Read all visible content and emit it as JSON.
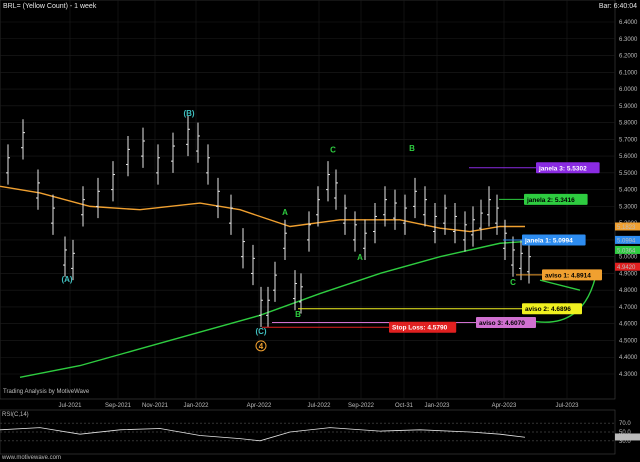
{
  "header": {
    "symbol_title": "BRL= (Yellow Count) - 1 week",
    "bar_time": "Bar: 6:40:04"
  },
  "footer": {
    "credit": "Trading Analysis by MotiveWave",
    "watermark": "www.motivewave.com"
  },
  "rsi_panel": {
    "title": "RSI(C,14)",
    "ticks": [
      "70.0",
      "50.0",
      "30.0"
    ],
    "current_value": "38.7"
  },
  "chart_data": {
    "type": "candlestick",
    "title": "BRL= (Yellow Count) - 1 week",
    "x_ticks": [
      "Jul-2021",
      "Sep-2021",
      "Nov-2021",
      "Jan-2022",
      "Apr-2022",
      "Jul-2022",
      "Sep-2022",
      "Oct-31",
      "Jan-2023",
      "Apr-2023",
      "Jul-2023"
    ],
    "y_ticks": [
      "6.4000",
      "6.3000",
      "6.2000",
      "6.1000",
      "6.0000",
      "5.9000",
      "5.8000",
      "5.7000",
      "5.6000",
      "5.5000",
      "5.4000",
      "5.3000",
      "5.2000",
      "5.1000",
      "5.0000",
      "4.9000",
      "4.8000",
      "4.7000",
      "4.6000",
      "4.5000",
      "4.4000",
      "4.3000"
    ],
    "ylim": [
      4.25,
      6.45
    ],
    "price_tags": [
      {
        "text": "5.1823",
        "color": "#f0a030"
      },
      {
        "text": "5.0994",
        "color": "#2d8cf0"
      },
      {
        "text": "5.0364",
        "color": "#2ecc40"
      },
      {
        "text": "4.9420",
        "color": "#e02020"
      }
    ],
    "levels": [
      {
        "label": "janela 3: 5.5302",
        "value": 5.5302,
        "color": "#8a2be2",
        "text_color": "#ffffff"
      },
      {
        "label": "janela 2: 5.3416",
        "value": 5.3416,
        "color": "#2ecc40",
        "text_color": "#000000"
      },
      {
        "label": "janela 1: 5.0994",
        "value": 5.0994,
        "color": "#2d8cf0",
        "text_color": "#ffffff"
      },
      {
        "label": "aviso 1: 4.8914",
        "value": 4.8914,
        "color": "#f0a030",
        "text_color": "#000000"
      },
      {
        "label": "aviso 2: 4.6896",
        "value": 4.6896,
        "color": "#f0f020",
        "text_color": "#000000"
      },
      {
        "label": "aviso 3: 4.6070",
        "value": 4.607,
        "color": "#d070d0",
        "text_color": "#000000"
      },
      {
        "label": "Stop Loss: 4.5790",
        "value": 4.579,
        "color": "#e02020",
        "text_color": "#ffffff"
      }
    ],
    "wave_labels": [
      {
        "text": "(A)",
        "color": "#40c0c0"
      },
      {
        "text": "(B)",
        "color": "#40c0c0"
      },
      {
        "text": "(C)",
        "color": "#40c0c0"
      },
      {
        "text": "4",
        "color": "#f0a030"
      },
      {
        "text": "A",
        "color": "#2ecc40"
      },
      {
        "text": "B",
        "color": "#2ecc40"
      },
      {
        "text": "C",
        "color": "#2ecc40"
      },
      {
        "text": "A",
        "color": "#2ecc40"
      },
      {
        "text": "B",
        "color": "#2ecc40"
      },
      {
        "text": "C",
        "color": "#2ecc40"
      }
    ]
  }
}
